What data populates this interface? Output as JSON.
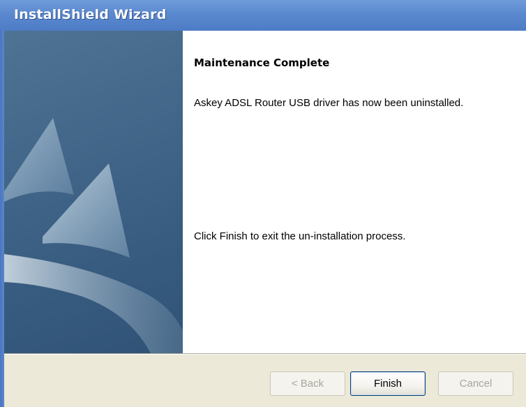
{
  "window": {
    "title": "InstallShield Wizard"
  },
  "content": {
    "heading": "Maintenance Complete",
    "message": "Askey ADSL Router USB driver has now been uninstalled.",
    "instruction": "Click Finish to exit the un-installation process."
  },
  "buttons": {
    "back_label": "< Back",
    "back_enabled": false,
    "finish_label": "Finish",
    "finish_enabled": true,
    "cancel_label": "Cancel",
    "cancel_enabled": false
  },
  "colors": {
    "title_bar": "#5b89cf",
    "side_panel": "#3f6487",
    "dialog_face": "#ece9d8",
    "content_background": "#ffffff"
  },
  "icons": {
    "side_panel_art": "sail-swoosh-graphic"
  }
}
